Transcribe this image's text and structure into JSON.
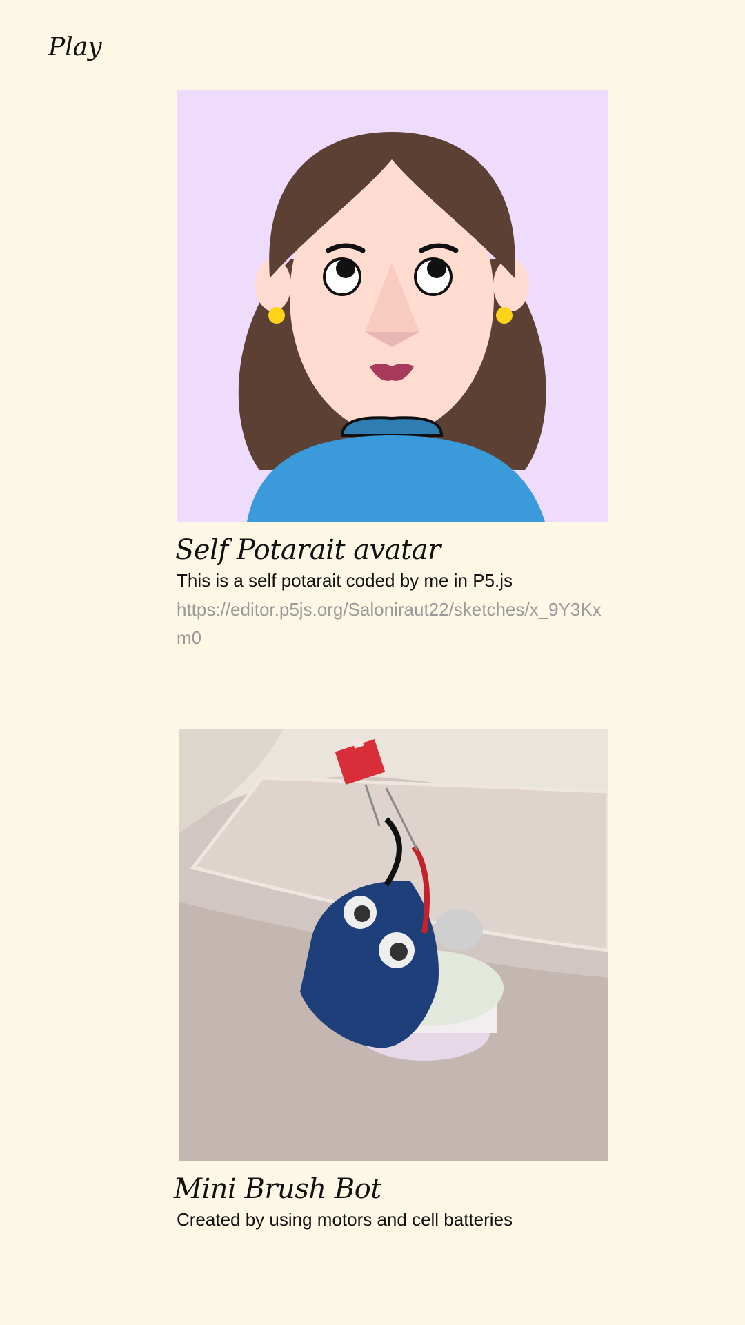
{
  "nav": {
    "title": "Play"
  },
  "projects": [
    {
      "title": "Self Potarait avatar",
      "description": "This is a self potarait coded by me in P5.js",
      "link": "https://editor.p5js.org/Saloniraut22/sketches/x_9Y3Kxm0"
    },
    {
      "title": "Mini Brush Bot",
      "description": "Created by using motors and cell batteries"
    }
  ],
  "colors": {
    "background": "#fdf8e6",
    "avatar_bg": "#efdcfd",
    "hair": "#5c4033",
    "skin": "#ffdbd0",
    "shirt": "#3a9ada",
    "link": "#9a9a9a"
  }
}
